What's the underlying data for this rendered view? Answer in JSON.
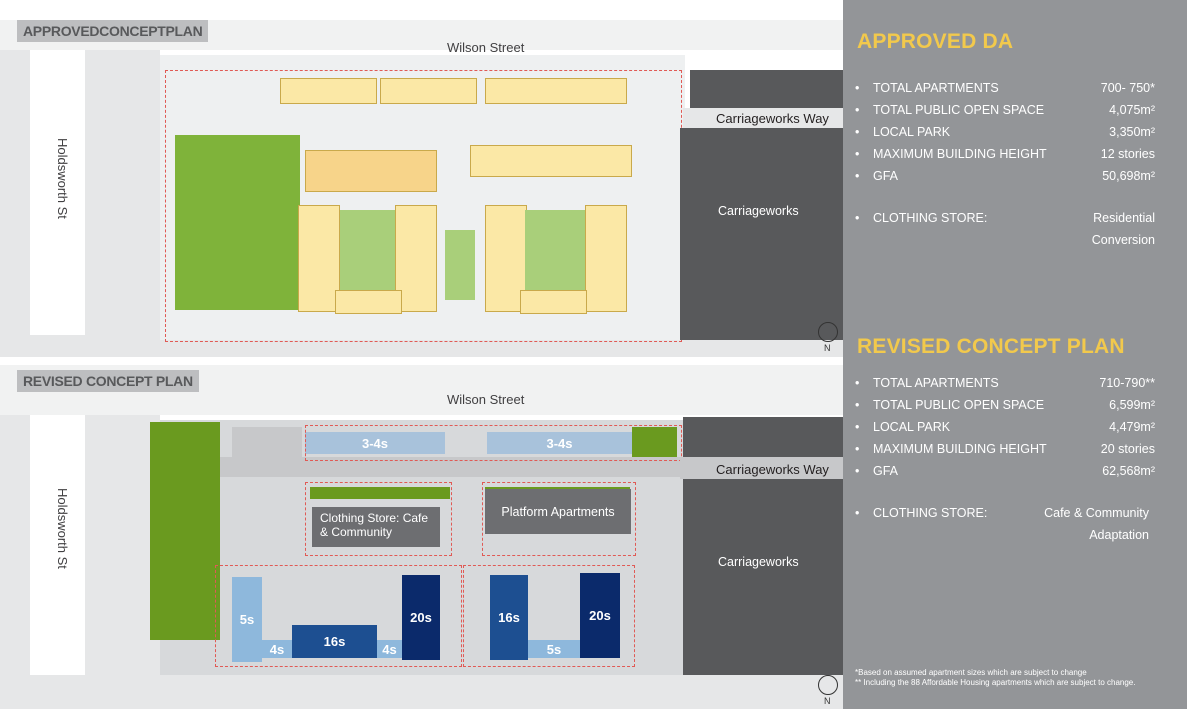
{
  "approved_plan": {
    "label": "APPROVEDCONCEPTPLAN",
    "street_top": "Wilson Street",
    "street_left": "Holdsworth St",
    "street_right": "Carriageworks Way",
    "carriageworks_label": "Carriageworks",
    "north": "N"
  },
  "revised_plan": {
    "label": "REVISED CONCEPT PLAN",
    "street_top": "Wilson Street",
    "street_left": "Holdsworth St",
    "street_right": "Carriageworks Way",
    "carriageworks_label": "Carriageworks",
    "north": "N",
    "buildings": {
      "b1": "3-4s",
      "b2": "3-4s",
      "clothing_store": "Clothing Store: Cafe & Community",
      "platform": "Platform Apartments",
      "five_left": "5s",
      "four_a": "4s",
      "sixteen_a": "16s",
      "four_b": "4s",
      "twenty_a": "20s",
      "sixteen_b": "16s",
      "five_right": "5s",
      "twenty_b": "20s"
    }
  },
  "approved_da": {
    "title": "APPROVED DA",
    "rows": [
      {
        "label": "TOTAL APARTMENTS",
        "value": "700- 750*"
      },
      {
        "label": "TOTAL PUBLIC OPEN SPACE",
        "value": "4,075m²"
      },
      {
        "label": "LOCAL PARK",
        "value": "3,350m²"
      },
      {
        "label": "MAXIMUM BUILDING HEIGHT",
        "value": "12 stories"
      },
      {
        "label": "GFA",
        "value": "50,698m²"
      }
    ],
    "clothing_label": "CLOTHING STORE:",
    "clothing_value_1": "Residential",
    "clothing_value_2": "Conversion"
  },
  "revised_concept": {
    "title": "REVISED CONCEPT PLAN",
    "rows": [
      {
        "label": "TOTAL APARTMENTS",
        "value": "710-790**"
      },
      {
        "label": "TOTAL PUBLIC OPEN SPACE",
        "value": "6,599m²"
      },
      {
        "label": "LOCAL PARK",
        "value": "4,479m²"
      },
      {
        "label": "MAXIMUM BUILDING HEIGHT",
        "value": "20 stories"
      },
      {
        "label": "GFA",
        "value": "62,568m²"
      }
    ],
    "clothing_label": "CLOTHING STORE:",
    "clothing_value_1": "Cafe & Community",
    "clothing_value_2": "Adaptation"
  },
  "notes": {
    "note1": "*Based on assumed apartment sizes which are subject to change",
    "note2": "** Including the 88 Affordable Housing apartments which are subject to change."
  },
  "colors": {
    "panel_bg": "#939598",
    "title_yellow": "#f2c94c",
    "park_green": "#6a9a1f",
    "tower_dark_blue": "#0b2a6b",
    "low_rise_light_blue": "#a8c2db"
  }
}
